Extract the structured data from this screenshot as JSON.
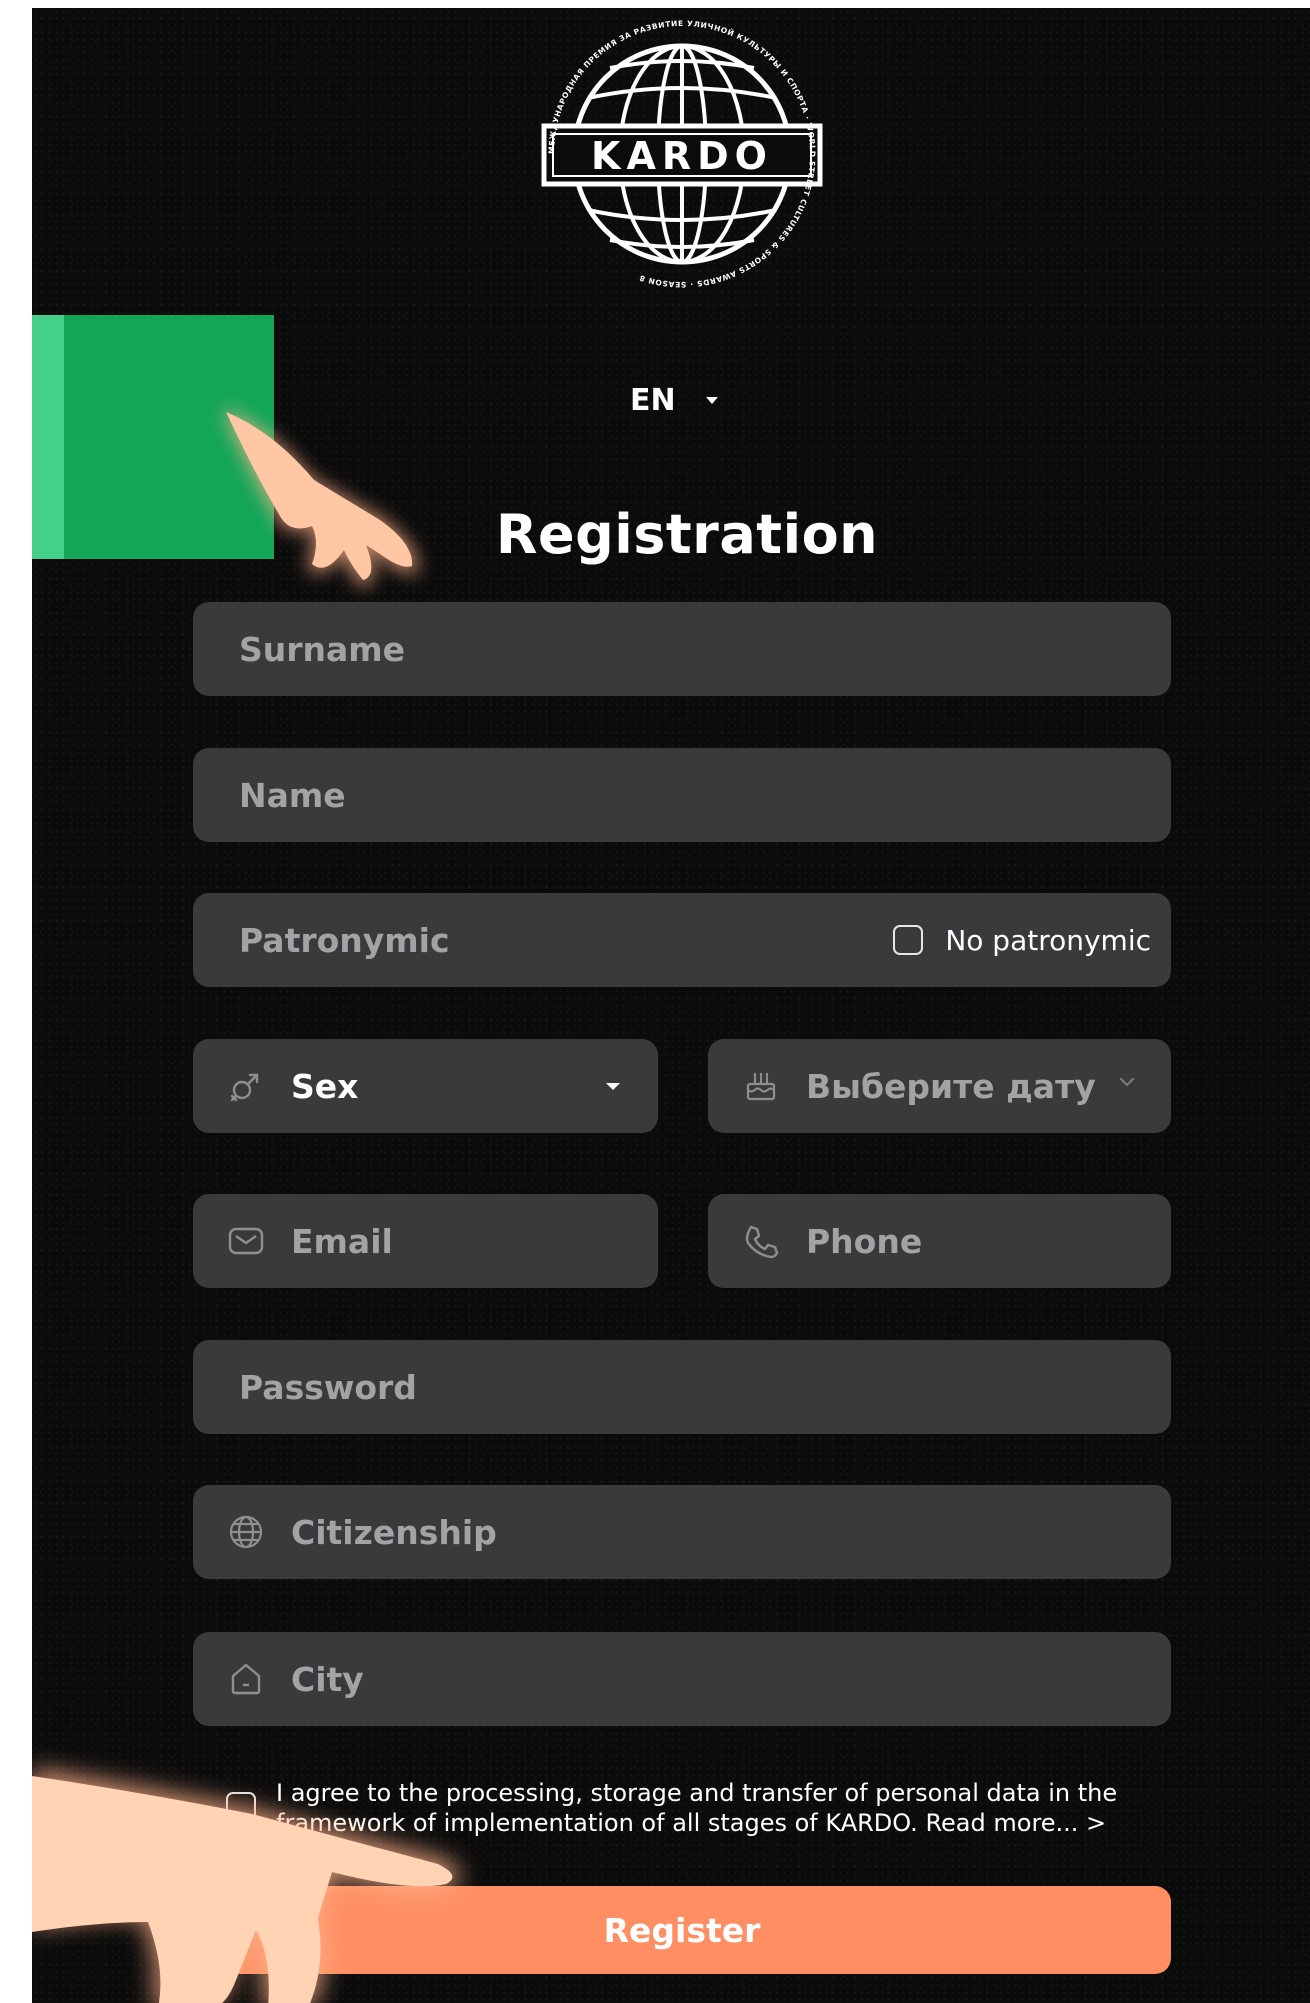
{
  "logo": {
    "brand": "KARDO",
    "ring_text": "МЕЖДУНАРОДНАЯ ПРЕМИЯ ЗА РАЗВИТИЕ УЛИЧНОЙ КУЛЬТУРЫ И СПОРТА · WORLD STREET CULTURES & SPORTS AWARDS · SEASON 8"
  },
  "language": {
    "selected": "EN"
  },
  "form": {
    "title": "Registration",
    "surname_placeholder": "Surname",
    "name_placeholder": "Name",
    "patronymic_placeholder": "Patronymic",
    "no_patronymic_label": "No patronymic",
    "sex_label": "Sex",
    "date_placeholder": "Выберите дату",
    "email_placeholder": "Email",
    "phone_placeholder": "Phone",
    "password_placeholder": "Password",
    "citizenship_placeholder": "Citizenship",
    "city_placeholder": "City",
    "agreement_text": "I agree to the processing, storage and transfer of personal data in the framework of implementation of all stages of KARDO. Read more... >",
    "register_label": "Register"
  },
  "icons": {
    "sex": "gender-icon",
    "date": "cake-icon",
    "email": "mail-icon",
    "phone": "phone-icon",
    "citizenship": "globe-icon",
    "city": "home-icon"
  },
  "colors": {
    "background": "#0b0b0b",
    "field": "#3a3a3c",
    "accent_green": "#13a659",
    "register_button": "#ff8f63"
  }
}
